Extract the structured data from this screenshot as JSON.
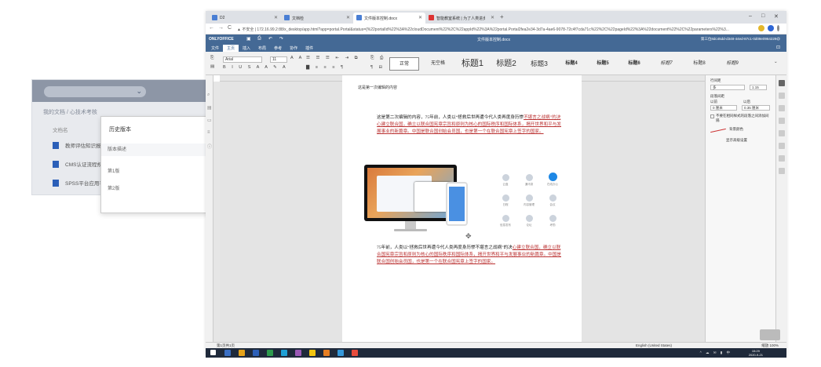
{
  "background_app": {
    "breadcrumb": "我的文档 / 心技术考核",
    "column_header": "文档名",
    "files": [
      "教师评估知识报告",
      "CMS认证流程规格",
      "SPSS平台应用平"
    ],
    "dialog": {
      "title": "历史版本",
      "items": [
        "版本描述",
        "第1版",
        "第2版"
      ]
    }
  },
  "browser": {
    "tabs": [
      {
        "label": "D2"
      },
      {
        "label": "文档检"
      },
      {
        "label": "文件版本控制.docx"
      },
      {
        "label": "智能教室系统 | 为了人类进步而努力"
      }
    ],
    "new_tab": "+",
    "window_controls": [
      "–",
      "□",
      "✕"
    ],
    "nav": [
      "←",
      "→",
      "C"
    ],
    "url": "▲ 不安全 | 172.16.99.2:88/x_desktop/app.html?app=portal.Portal&status={%22portalId%22%3A%22cloudDocument%22%2C%22appId%22%3A%22portal.Portal2fea2e34-3d7a-4ae6-9078-72c4f7cda71c%22%2C%22pageId%22%3A%22document%22%2C%22parameters%22%3..."
  },
  "editor": {
    "logo": "ONLYOFFICE",
    "doc_title": "文件版本控制.docx",
    "user": "第三位8dc45dd-d348-44ed-87c1-0d09e0964229@",
    "menu": [
      "文件",
      "主页",
      "插入",
      "布局",
      "参考",
      "协作",
      "插件"
    ],
    "active_menu": 1,
    "font_name": "Arial",
    "font_size": "11",
    "styles": [
      "正常",
      "无空格",
      "标题1",
      "标题2",
      "标题3",
      "标题4",
      "标题5",
      "标题6",
      "标题7",
      "标题8",
      "标题9"
    ],
    "page_header": "这是第一次编辑的内容",
    "para1_plain": "这是第二次编辑的内容，75年前，人类以“拯救后世再遭今代人类再度身历惨",
    "para1_underlined": "不堪言之战祸”的决心建立联合国，确立以联合国宪章宗旨和原则为核心的国际秩序和国际体系，揭开世界和平与发展事业的新篇章。中国是联合国创始会员国，也是第一个在联合国宪章上签字的国家。",
    "para2_plain": "75年前，人类以“拯救后世再遭今代人类再度身历惨不堪言之战祸”的决",
    "para2_underlined": "心建立联合国，确立以联合国宪章宗旨和原则为核心的国际秩序和国际体系，揭开世界和平与发展事业的新篇章。中国是联合国创始会员国，也是第一个在联合国宪章上签字的国家。",
    "apps": [
      "云盘",
      "通讯录",
      "在线办公",
      "日程",
      "内容管理",
      "会议",
      "信息发布",
      "论坛",
      "考勤"
    ],
    "right_panel": {
      "line_spacing_label": "行间距",
      "line_spacing_type": "多",
      "line_spacing_value": "1.15",
      "para_spacing_label": "段落间距",
      "before_label": "以前",
      "after_label": "以后",
      "before_value": "0 厘米",
      "after_value": "0.35 厘米",
      "checkbox_label": "不要在相同样式的段落之间添加间隔",
      "bg_color_label": "背景颜色",
      "advanced_label": "显示高级设置"
    },
    "status": {
      "page": "第1页共1页",
      "language": "English (United States)",
      "zoom": "缩放 100%"
    }
  },
  "taskbar": {
    "time": "15:29",
    "date": "2020-9-21",
    "tray": "^ ☁ ✉ ▮ 中"
  }
}
